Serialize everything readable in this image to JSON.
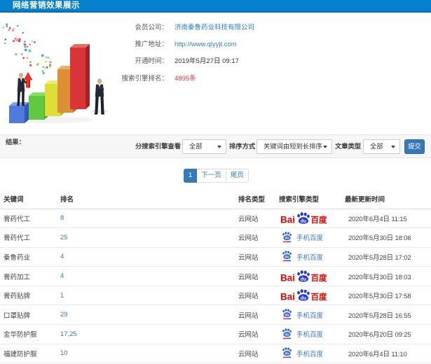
{
  "header": {
    "title": "网络营销效果展示"
  },
  "info": {
    "fields": [
      {
        "label": "会员公司：",
        "value": "济南秦鲁药业科技有限公司",
        "type": "link"
      },
      {
        "label": "推广地址：",
        "value": "http://www.qlyyjt.com",
        "type": "link"
      },
      {
        "label": "开通时间：",
        "value": "2019年5月27日 09:17",
        "type": "text"
      },
      {
        "label": "搜索引擎排名：",
        "value": "4895条",
        "type": "count"
      }
    ]
  },
  "filters": {
    "result_label": "结果：",
    "engine_label": "分搜索引擎查看",
    "engine_value": "全部",
    "sort_label": "排序方式",
    "sort_value": "关键词由短到长排序",
    "type_label": "文章类型",
    "type_value": "全部",
    "submit_label": "提交"
  },
  "pagination": {
    "current": "1",
    "next": "下一页",
    "last": "尾页"
  },
  "table": {
    "headers": [
      "关键词",
      "排名",
      "排名类型",
      "搜索引擎类型",
      "最新更新时间"
    ],
    "engine_logos": {
      "baidu": {
        "prefix": "Bai",
        "du": "du",
        "suffix": "百度"
      },
      "shouji": {
        "du": "du",
        "label": "手机百度"
      }
    },
    "rows": [
      {
        "keyword": "膏药代工",
        "rank": "8",
        "rank_type": "云网站",
        "engine": "baidu",
        "updated": "2020年6月4日 11:15"
      },
      {
        "keyword": "膏药代工",
        "rank": "25",
        "rank_type": "云网站",
        "engine": "shouji",
        "updated": "2020年5月30日 18:06"
      },
      {
        "keyword": "秦鲁药业",
        "rank": "4",
        "rank_type": "云网站",
        "engine": "shouji",
        "updated": "2020年5月28日 17:02"
      },
      {
        "keyword": "膏药加工",
        "rank": "4",
        "rank_type": "云网站",
        "engine": "baidu",
        "updated": "2020年5月30日 18:03"
      },
      {
        "keyword": "膏药贴牌",
        "rank": "1",
        "rank_type": "云网站",
        "engine": "baidu",
        "updated": "2020年5月30日 17:58"
      },
      {
        "keyword": "口罩贴牌",
        "rank": "29",
        "rank_type": "云网站",
        "engine": "shouji",
        "updated": "2020年5月28日 16:55"
      },
      {
        "keyword": "金华防护服",
        "rank": "17,25",
        "rank_type": "云网站",
        "engine": "shouji",
        "updated": "2020年6月20日 09:25"
      },
      {
        "keyword": "福建防护服",
        "rank": "10",
        "rank_type": "云网站",
        "engine": "shouji",
        "updated": "2020年6月4日 11:10"
      }
    ]
  },
  "colors": {
    "topbar_blue": "#0580ca",
    "primary_blue": "#337ab7",
    "link_blue": "#2e7fd0",
    "count_red": "#e4393c",
    "baidu_red": "#e10602",
    "baidu_blue": "#2433dc",
    "mobile_text_blue": "#3b76d6"
  }
}
